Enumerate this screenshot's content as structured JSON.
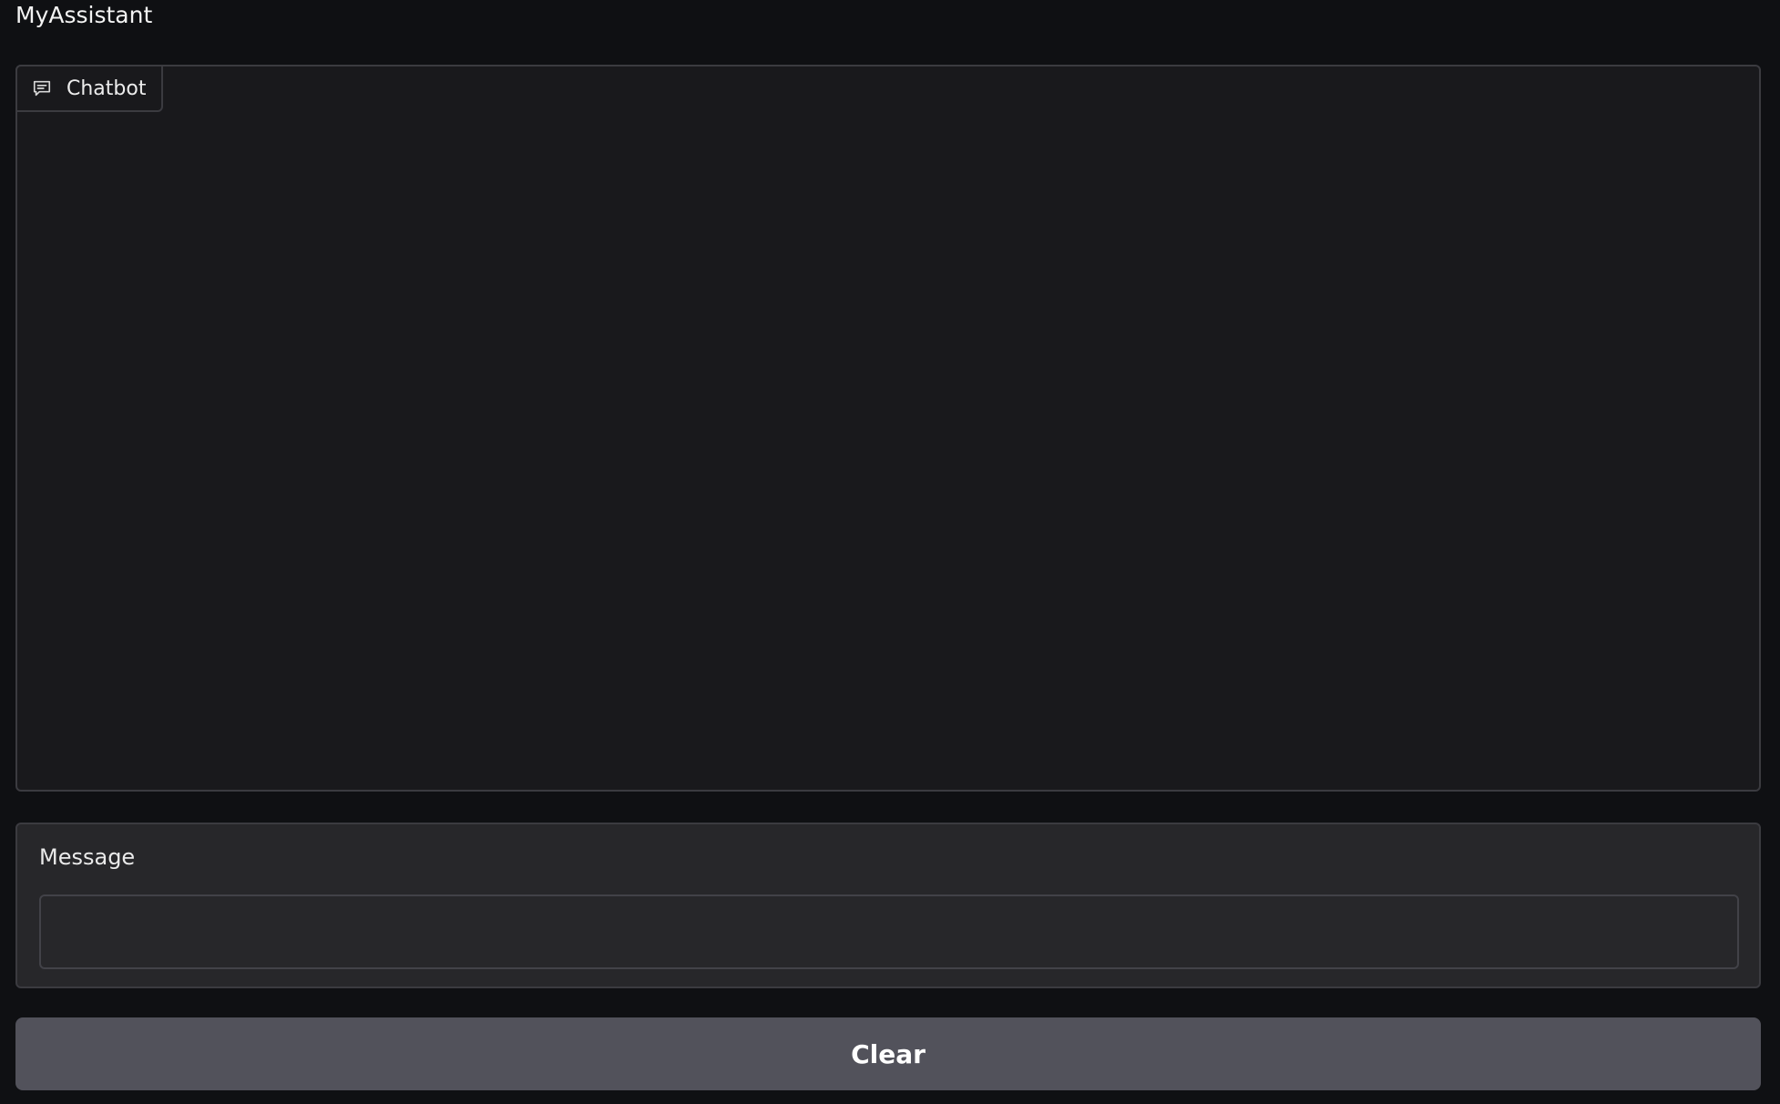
{
  "app": {
    "title": "MyAssistant"
  },
  "chatbot": {
    "label": "Chatbot",
    "icon": "chat-icon",
    "messages": []
  },
  "message": {
    "label": "Message",
    "value": "",
    "placeholder": ""
  },
  "actions": {
    "clear_label": "Clear"
  },
  "colors": {
    "background": "#0f1013",
    "panel": "#19191c",
    "input_panel": "#27272a",
    "border": "#3b3b40",
    "button": "#52525b"
  }
}
